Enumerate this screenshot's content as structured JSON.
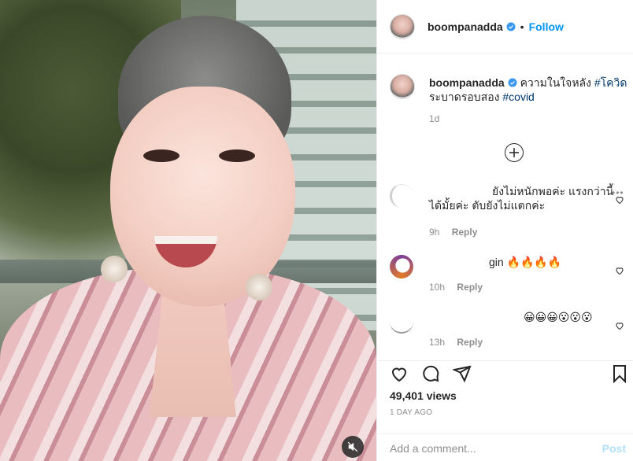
{
  "post": {
    "username": "boompanadda",
    "follow_label": "Follow",
    "separator": "•",
    "caption_text": "ความในใจหลัง",
    "caption_tag1": "#โควิด",
    "caption_text2": "ระบาดรอบสอง",
    "caption_tag2": "#covid",
    "caption_time": "1d"
  },
  "comments": [
    {
      "text_line1": "ยังไม่หนักพอค่ะ แรงกว่านี้",
      "text_line2": "ได้มั้ยค่ะ ตับยังไม่แตกค่ะ",
      "time": "9h",
      "reply_label": "Reply",
      "more": "•••"
    },
    {
      "text": "gin 🔥🔥🔥🔥",
      "time": "10h",
      "reply_label": "Reply"
    },
    {
      "text": "😀😀😀😮😮😮",
      "time": "13h",
      "reply_label": "Reply"
    }
  ],
  "footer": {
    "views": "49,401 views",
    "date": "1 DAY AGO",
    "comment_placeholder": "Add a comment...",
    "post_label": "Post"
  },
  "icons": {
    "verified": "verified-badge-icon",
    "heart": "heart-icon",
    "comment": "comment-icon",
    "share": "share-icon",
    "save": "bookmark-icon",
    "mute": "speaker-muted-icon",
    "load_more": "plus-circle-icon"
  },
  "colors": {
    "accent": "#0095f6",
    "verified": "#3897f0",
    "post_disabled": "#b2dffc",
    "meta": "#8e8e8e"
  }
}
